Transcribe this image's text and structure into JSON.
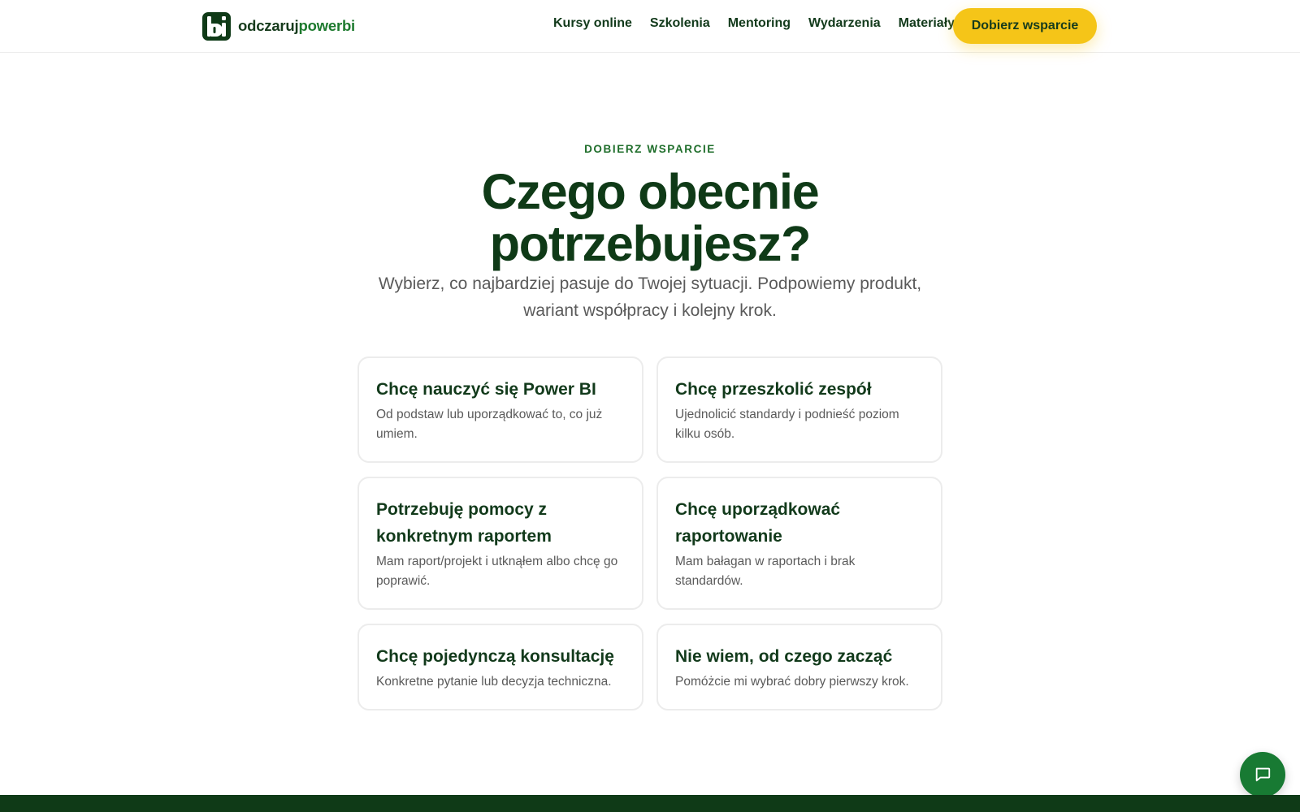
{
  "header": {
    "logo": {
      "part1": "odczaruj",
      "part2": "powerbi",
      "icon": "bi-logo-icon"
    },
    "nav": [
      "Kursy online",
      "Szkolenia",
      "Mentoring",
      "Wydarzenia",
      "Materiały"
    ],
    "cta_label": "Dobierz wsparcie"
  },
  "hero": {
    "eyebrow": "DOBIERZ WSPARCIE",
    "title_line1": "Czego obecnie",
    "title_line2": "potrzebujesz?",
    "subtitle_line1": "Wybierz, co najbardziej pasuje do Twojej sytuacji. Podpowiemy produkt,",
    "subtitle_line2": "wariant współpracy i kolejny krok."
  },
  "cards": [
    {
      "title": "Chcę nauczyć się Power BI",
      "desc": "Od podstaw lub uporządkować to, co już umiem."
    },
    {
      "title": "Chcę przeszkolić zespół",
      "desc": "Ujednolicić standardy i podnieść poziom kilku osób."
    },
    {
      "title": "Potrzebuję pomocy z konkretnym raportem",
      "desc": "Mam raport/projekt i utknąłem albo chcę go poprawić."
    },
    {
      "title": "Chcę uporządkować raportowanie",
      "desc": "Mam bałagan w raportach i brak standardów."
    },
    {
      "title": "Chcę pojedynczą konsultację",
      "desc": "Konkretne pytanie lub decyzja techniczna."
    },
    {
      "title": "Nie wiem, od czego zacząć",
      "desc": "Pomóżcie mi wybrać dobry pierwszy krok."
    }
  ],
  "chat": {
    "icon": "chat-bubble-icon"
  },
  "colors": {
    "brand_dark": "#0f3a17",
    "brand_green": "#1d7a2e",
    "accent_yellow": "#f5c518"
  }
}
